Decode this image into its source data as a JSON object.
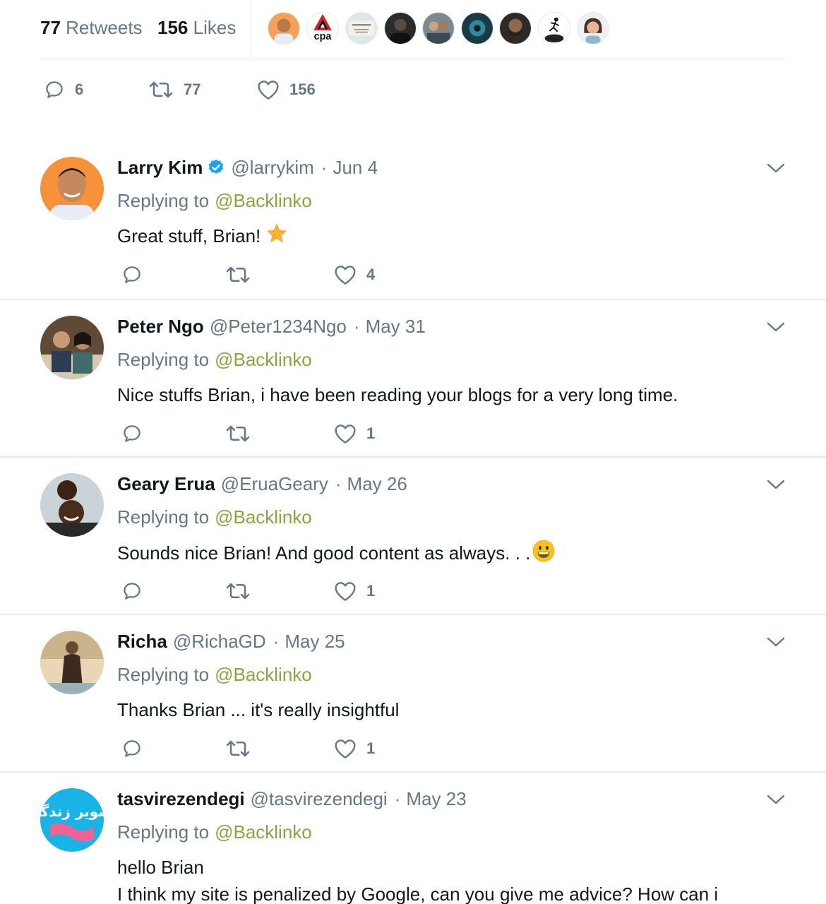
{
  "stats": {
    "retweets_count": "77",
    "retweets_label": "Retweets",
    "likes_count": "156",
    "likes_label": "Likes",
    "liker_avatars": [
      "avatar-man-orange",
      "cpa-logo",
      "book-cover",
      "avatar-dark",
      "avatar-group",
      "avatar-teal",
      "avatar-beard",
      "avatar-runner",
      "avatar-woman"
    ]
  },
  "main_actions": {
    "reply_count": "6",
    "retweet_count": "77",
    "like_count": "156"
  },
  "replies": [
    {
      "name": "Larry Kim",
      "verified": true,
      "handle": "@larrykim",
      "separator": "·",
      "date": "Jun 4",
      "replying_prefix": "Replying to",
      "replying_to": "@Backlinko",
      "text_lines": [
        "Great stuff, Brian!"
      ],
      "emoji": "star-emoji",
      "like_count": "4"
    },
    {
      "name": "Peter Ngo",
      "verified": false,
      "handle": "@Peter1234Ngo",
      "separator": "·",
      "date": "May 31",
      "replying_prefix": "Replying to",
      "replying_to": "@Backlinko",
      "text_lines": [
        "Nice stuffs Brian, i have been reading your blogs for a very long time."
      ],
      "like_count": "1"
    },
    {
      "name": "Geary Erua",
      "verified": false,
      "handle": "@EruaGeary",
      "separator": "·",
      "date": "May 26",
      "replying_prefix": "Replying to",
      "replying_to": "@Backlinko",
      "text_lines": [
        "Sounds nice Brian! And good content as always. . ."
      ],
      "emoji": "grinning-face-emoji",
      "like_count": "1"
    },
    {
      "name": "Richa",
      "verified": false,
      "handle": "@RichaGD",
      "separator": "·",
      "date": "May 25",
      "replying_prefix": "Replying to",
      "replying_to": "@Backlinko",
      "text_lines": [
        "Thanks Brian ... it's really insightful"
      ],
      "like_count": "1"
    },
    {
      "name": "tasvirezendegi",
      "verified": false,
      "handle": "@tasvirezendegi",
      "separator": "·",
      "date": "May 23",
      "replying_prefix": "Replying to",
      "replying_to": "@Backlinko",
      "text_lines": [
        "hello Brian",
        "I think my site is penalized by Google, can you give me advice? How can i"
      ],
      "logo_text": "تصویر زندگی"
    }
  ],
  "colors": {
    "text": "#14171a",
    "muted": "#657786",
    "mention": "#8aa442",
    "divider": "#e6ecf0",
    "verified": "#1da1f2"
  }
}
